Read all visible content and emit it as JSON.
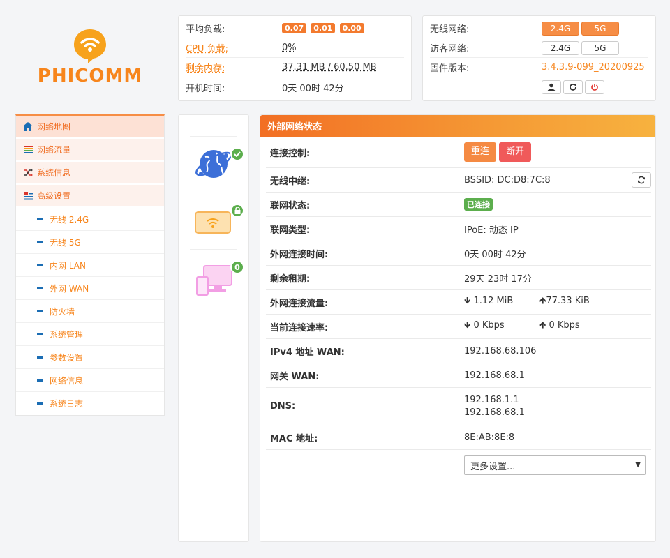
{
  "brand": {
    "logo_text": "PHICOMM",
    "accent": "#f7851c"
  },
  "info": {
    "load_label": "平均负载:",
    "load_values": [
      "0.07",
      "0.01",
      "0.00"
    ],
    "cpu_label": "CPU 负载:",
    "cpu_value": "0%",
    "mem_label": "剩余内存:",
    "mem_value": "37.31 MB / 60.50 MB",
    "uptime_label": "开机时间:",
    "uptime_value": "0天 00时 42分"
  },
  "wifi": {
    "wireless_label": "无线网络:",
    "guest_label": "访客网络:",
    "band_24": "2.4G",
    "band_5": "5G",
    "firmware_label": "固件版本:",
    "firmware_value": "3.4.3.9-099_20200925"
  },
  "sidebar": {
    "items": [
      {
        "label": "网络地图",
        "icon": "home-icon"
      },
      {
        "label": "网络流量",
        "icon": "traffic-icon"
      },
      {
        "label": "系统信息",
        "icon": "shuffle-icon"
      },
      {
        "label": "高级设置",
        "icon": "advanced-icon"
      }
    ],
    "sub_items": [
      "无线 2.4G",
      "无线 5G",
      "内网 LAN",
      "外网 WAN",
      "防火墙",
      "系统管理",
      "参数设置",
      "网络信息",
      "系统日志"
    ]
  },
  "status": {
    "clients_count": "0"
  },
  "main": {
    "title": "外部网络状态",
    "conn_label": "连接控制:",
    "reconnect": "重连",
    "disconnect": "断开",
    "relay_label": "无线中继:",
    "relay_value": "BSSID: DC:D8:7C:8",
    "net_status_label": "联网状态:",
    "net_status_value": "已连接",
    "net_type_label": "联网类型:",
    "net_type_value": "IPoE: 动态 IP",
    "wan_time_label": "外网连接时间:",
    "wan_time_value": "0天 00时 42分",
    "lease_label": "剩余租期:",
    "lease_value": "29天 23时 17分",
    "traffic_label": "外网连接流量:",
    "traffic_down": "1.12 MiB",
    "traffic_up": "77.33 KiB",
    "speed_label": "当前连接速率:",
    "speed_down": "0 Kbps",
    "speed_up": "0 Kbps",
    "ipv4_label": "IPv4 地址 WAN:",
    "ipv4_value": "192.168.68.106",
    "gw_label": "网关 WAN:",
    "gw_value": "192.168.68.1",
    "dns_label": "DNS:",
    "dns_1": "192.168.1.1",
    "dns_2": "192.168.68.1",
    "mac_label": "MAC 地址:",
    "mac_value": "8E:AB:8E:8",
    "more_select": "更多设置..."
  }
}
